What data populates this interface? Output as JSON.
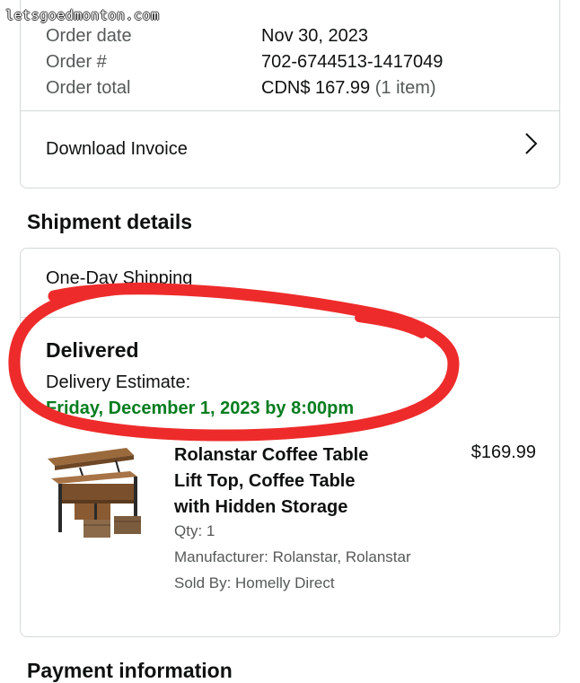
{
  "watermark": "letsgoedmonton.com",
  "order_summary": {
    "rows": [
      {
        "label": "Order date",
        "value": "Nov 30, 2023"
      },
      {
        "label": "Order #",
        "value": "702-6744513-1417049"
      },
      {
        "label": "Order total",
        "value": "CDN$ 167.99",
        "value_suffix": "(1 item)"
      }
    ],
    "download_invoice_label": "Download Invoice"
  },
  "shipment": {
    "section_title": "Shipment details",
    "shipping_method": "One-Day Shipping",
    "status": "Delivered",
    "estimate_label": "Delivery Estimate:",
    "estimate_date": "Friday, December 1, 2023 by 8:00pm",
    "item": {
      "title_lines": [
        "Rolanstar Coffee Table",
        "Lift Top, Coffee Table",
        "with Hidden Storage"
      ],
      "price": "$169.99",
      "qty": "Qty: 1",
      "manufacturer": "Manufacturer: Rolanstar, Rolanstar",
      "sold_by": "Sold By: Homelly Direct"
    }
  },
  "payment": {
    "section_title": "Payment information"
  },
  "colors": {
    "delivery_green": "#067d1f",
    "annotation_red": "#ee2b2b",
    "border": "#d5d9d9",
    "secondary_text": "#565959"
  },
  "icons": {
    "invoice_chevron": "chevron-right-icon",
    "product_image": "coffee-table-product-image"
  }
}
